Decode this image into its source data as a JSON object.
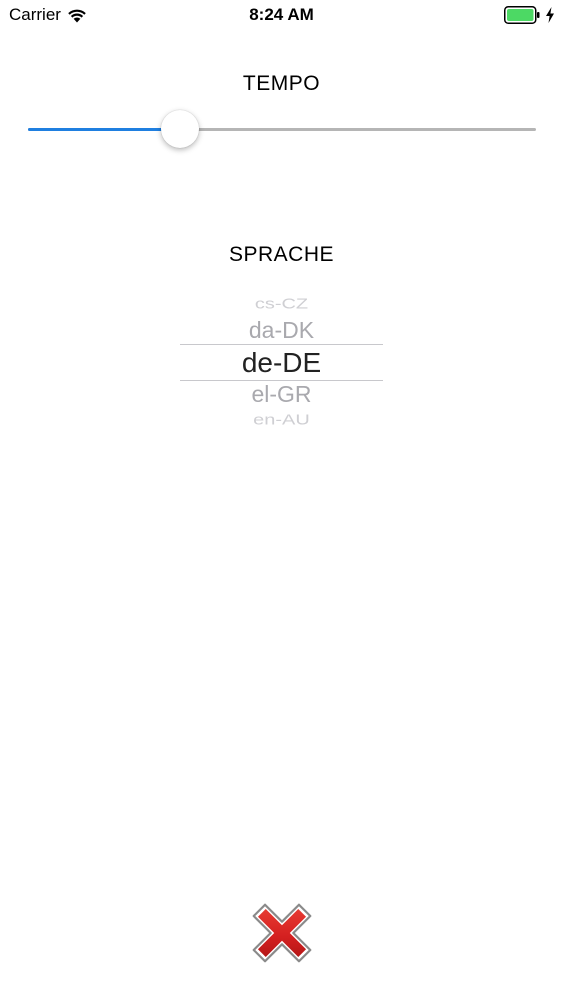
{
  "status_bar": {
    "carrier": "Carrier",
    "time": "8:24 AM",
    "wifi_icon": "wifi-icon",
    "battery_icon": "battery-icon",
    "charging_icon": "bolt-icon",
    "battery_color": "#4cd964"
  },
  "tempo": {
    "label": "TEMPO",
    "value_fraction": 0.3,
    "accent_color": "#1f7fe0"
  },
  "language": {
    "label": "SPRACHE",
    "options_visible": [
      "cs-CZ",
      "da-DK",
      "de-DE",
      "el-GR",
      "en-AU"
    ],
    "selected": "de-DE"
  },
  "close_button": {
    "icon": "close-icon",
    "color": "#d42020"
  }
}
